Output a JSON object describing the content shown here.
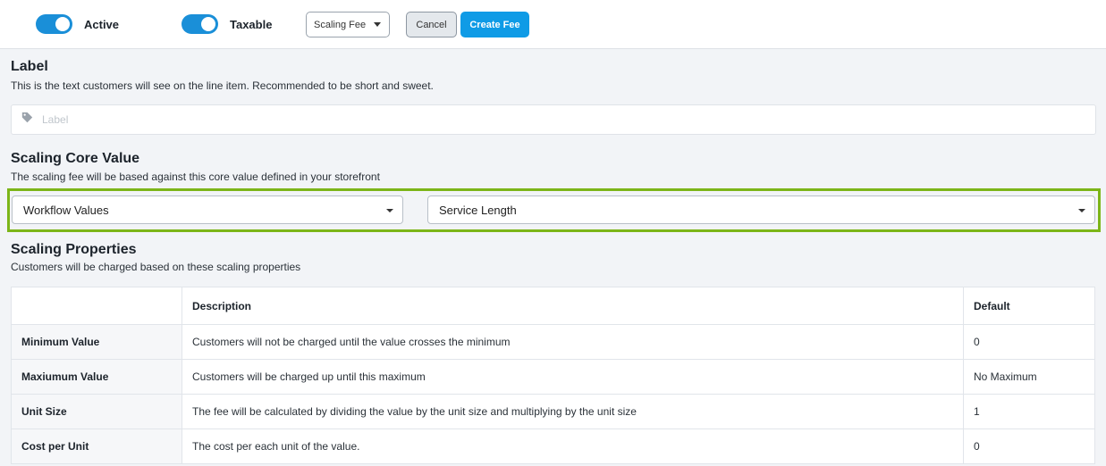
{
  "toolbar": {
    "active_label": "Active",
    "taxable_label": "Taxable",
    "fee_type": "Scaling Fee",
    "cancel_label": "Cancel",
    "create_label": "Create Fee"
  },
  "label_section": {
    "title": "Label",
    "description": "This is the text customers will see on the line item. Recommended to be short and sweet.",
    "input_value": "",
    "input_placeholder": "Label",
    "icon": "tag-icon"
  },
  "core_section": {
    "title": "Scaling Core Value",
    "description": "The scaling fee will be based against this core value defined in your storefront",
    "source_select": "Workflow Values",
    "value_select": "Service Length",
    "highlight_color": "#7cb518"
  },
  "properties_section": {
    "title": "Scaling Properties",
    "description": "Customers will be charged based on these scaling properties",
    "columns": [
      "",
      "Description",
      "Default"
    ],
    "rows": [
      {
        "name": "Minimum Value",
        "description": "Customers will not be charged until the value crosses the minimum",
        "default": "0"
      },
      {
        "name": "Maxiumum Value",
        "description": "Customers will be charged up until this maximum",
        "default": "No Maximum"
      },
      {
        "name": "Unit Size",
        "description": "The fee will be calculated by dividing the value by the unit size and multiplying by the unit size",
        "default": "1"
      },
      {
        "name": "Cost per Unit",
        "description": "The cost per each unit of the value.",
        "default": "0"
      }
    ]
  },
  "colors": {
    "accent": "#1a8fd8",
    "primary_button": "#0f9be6"
  }
}
